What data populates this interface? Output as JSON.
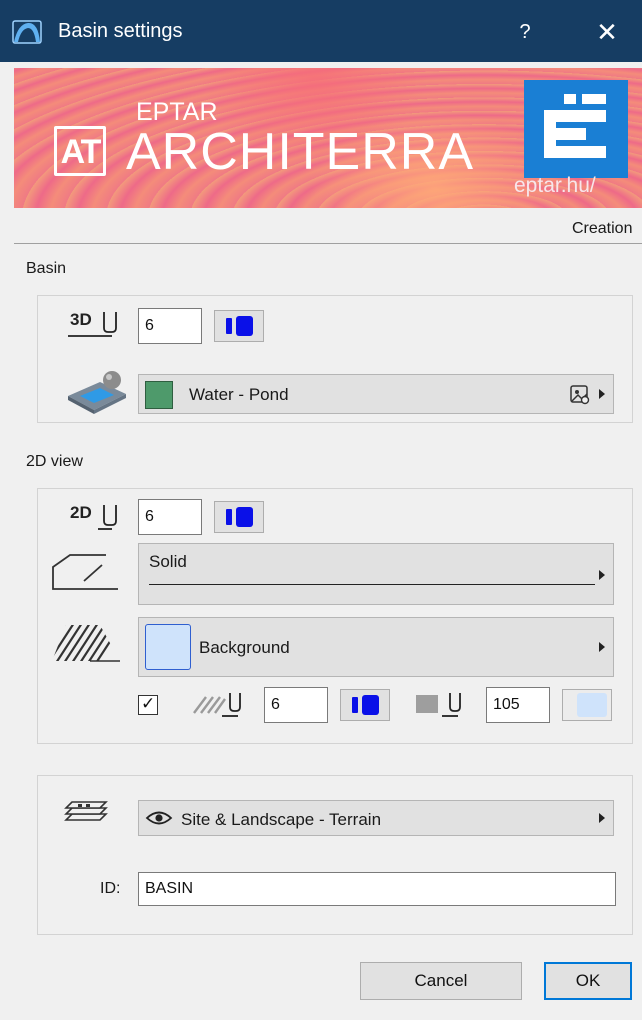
{
  "window": {
    "title": "Basin settings",
    "help_label": "?",
    "close_label": "✕",
    "title_bar_color": "#163d63"
  },
  "banner": {
    "logo_letters": "AT",
    "company": "EPTAR",
    "product": "ARCHITERRA",
    "url": "eptar.hu/"
  },
  "tab": {
    "label": "Creation"
  },
  "basin": {
    "section_label": "Basin",
    "pen_icon_label": "3D",
    "pen_value": "6",
    "surface_label": "Water - Pond",
    "surface_color": "#4e9a6b"
  },
  "view_2d": {
    "section_label": "2D view",
    "pen_icon_label": "2D",
    "pen_value": "6",
    "line_type_label": "Solid",
    "fill_label": "Background",
    "fill_swatch_color": "#cfe3fb",
    "fill_enabled": true,
    "fill_pen_value": "6",
    "background_pen_value": "105"
  },
  "layer": {
    "layer_label": "Site & Landscape - Terrain",
    "id_label": "ID:",
    "id_value": "BASIN"
  },
  "buttons": {
    "cancel_label": "Cancel",
    "ok_label": "OK"
  },
  "colors": {
    "pen_blue": "#0a10e8",
    "accent": "#0078d7"
  }
}
